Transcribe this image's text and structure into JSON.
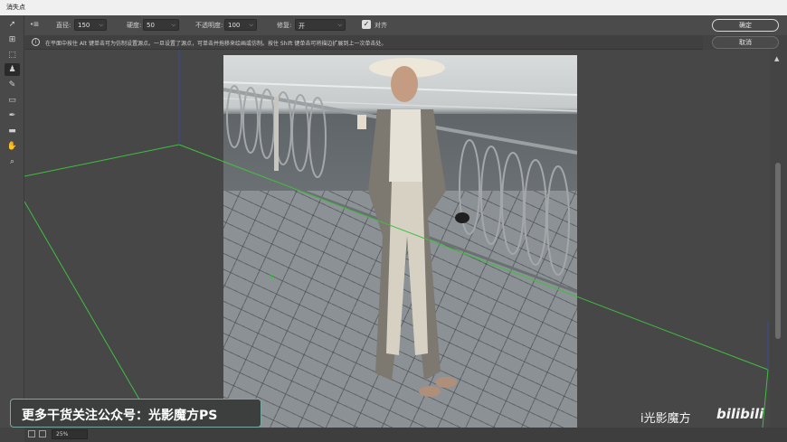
{
  "window": {
    "title": "消失点"
  },
  "options": {
    "diameter_label": "直径:",
    "diameter_value": "150",
    "hardness_label": "硬度:",
    "hardness_value": "50",
    "opacity_label": "不透明度:",
    "opacity_value": "100",
    "heal_label": "修复:",
    "heal_value": "开",
    "align_label": "对齐",
    "align_checked": true
  },
  "hint": "在平面中按住 Alt 键单击可为仿制设置源点。一旦设置了源点，可单击并拖移来绘画或仿制。按住 Shift 键单击可将描边扩展到上一次单击处。",
  "buttons": {
    "ok": "确定",
    "cancel": "取消"
  },
  "tools": [
    "edit-plane-icon",
    "create-plane-icon",
    "marquee-icon",
    "stamp-icon",
    "brush-icon",
    "transform-icon",
    "eyedropper-icon",
    "measure-icon",
    "hand-icon",
    "zoom-icon"
  ],
  "status": {
    "zoom": "25%"
  },
  "overlay": {
    "banner_text": "更多干货关注公众号：光影魔方PS",
    "watermark_1": "i光影魔方",
    "watermark_2": "bilibili"
  },
  "colors": {
    "plane_grid": "#3fbf3f",
    "accent": "#7aa9a3"
  }
}
